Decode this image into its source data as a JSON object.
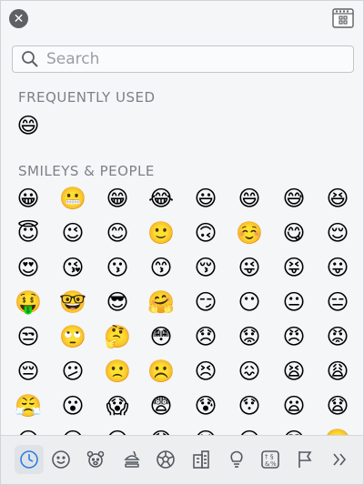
{
  "search": {
    "placeholder": "Search"
  },
  "sections": {
    "frequently_used": {
      "title": "FREQUENTLY USED",
      "emojis": [
        "😄"
      ]
    },
    "smileys": {
      "title": "SMILEYS & PEOPLE",
      "emojis": [
        "😀",
        "😬",
        "😁",
        "😂",
        "😃",
        "😄",
        "😅",
        "😆",
        "😇",
        "😉",
        "😊",
        "🙂",
        "🙃",
        "☺️",
        "😋",
        "😌",
        "😍",
        "😘",
        "😗",
        "😙",
        "😚",
        "😜",
        "😝",
        "😛",
        "🤑",
        "🤓",
        "😎",
        "🤗",
        "😏",
        "😶",
        "😐",
        "😑",
        "😒",
        "🙄",
        "🤔",
        "😳",
        "😞",
        "😟",
        "😠",
        "😡",
        "😔",
        "😕",
        "🙁",
        "☹️",
        "😣",
        "😖",
        "😫",
        "😩",
        "😤",
        "😮",
        "😱",
        "😨",
        "😰",
        "😯",
        "😦",
        "😧",
        "😢",
        "😥",
        "😪",
        "😓",
        "😭",
        "😵",
        "😲",
        "🤐"
      ]
    }
  },
  "categories": [
    {
      "name": "recent",
      "icon": "clock-icon",
      "active": true
    },
    {
      "name": "smileys",
      "icon": "smiley-icon",
      "active": false
    },
    {
      "name": "animals",
      "icon": "bear-icon",
      "active": false
    },
    {
      "name": "food",
      "icon": "burger-icon",
      "active": false
    },
    {
      "name": "activity",
      "icon": "ball-icon",
      "active": false
    },
    {
      "name": "travel",
      "icon": "building-icon",
      "active": false
    },
    {
      "name": "objects",
      "icon": "bulb-icon",
      "active": false
    },
    {
      "name": "symbols",
      "icon": "symbols-icon",
      "active": false
    },
    {
      "name": "flags",
      "icon": "flag-icon",
      "active": false
    },
    {
      "name": "more",
      "icon": "double-chevron-icon",
      "active": false
    }
  ],
  "colors": {
    "accent": "#2f7de1",
    "close": "#5e6064",
    "title": "#7d8186"
  }
}
